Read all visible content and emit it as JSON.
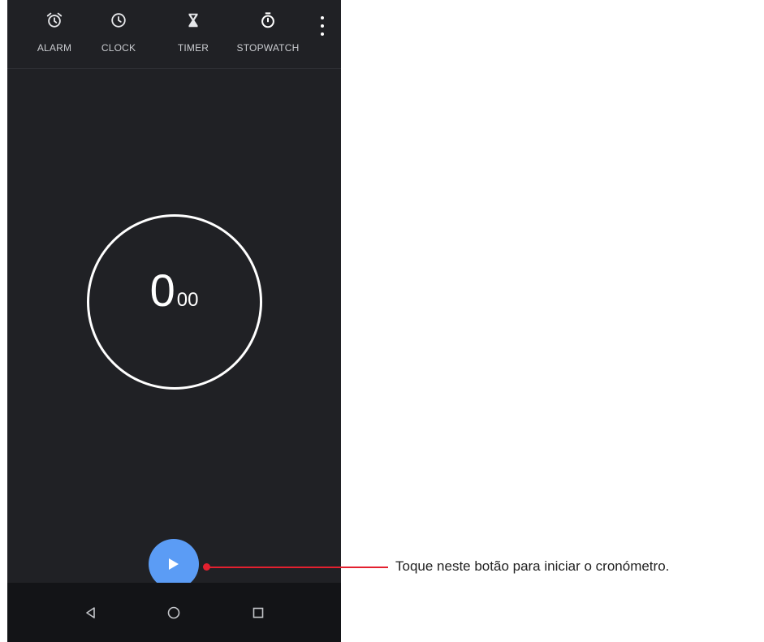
{
  "tabs": [
    {
      "label": "ALARM",
      "icon": "alarm-clock-icon",
      "active": false
    },
    {
      "label": "CLOCK",
      "icon": "clock-icon",
      "active": false
    },
    {
      "label": "TIMER",
      "icon": "hourglass-icon",
      "active": false
    },
    {
      "label": "STOPWATCH",
      "icon": "stopwatch-icon",
      "active": true
    }
  ],
  "stopwatch": {
    "seconds": "0",
    "centiseconds": "00"
  },
  "start_button": {
    "icon": "play-icon",
    "color": "#5b9cf5"
  },
  "navbar": {
    "icons": [
      "back-triangle-icon",
      "home-circle-icon",
      "recents-square-icon"
    ]
  },
  "annotation": {
    "text": "Toque neste botão para iniciar o cronómetro.",
    "color": "#e3202f"
  },
  "colors": {
    "background": "#202125",
    "navbar": "#131417",
    "accent": "#5b9cf5"
  }
}
